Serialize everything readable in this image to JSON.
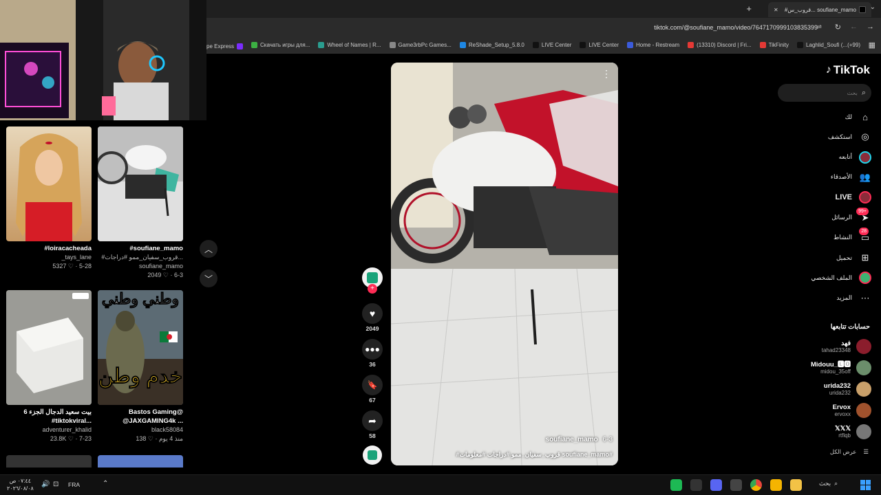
{
  "browser": {
    "tab_title": "#قروب_س... soufiane_mamo",
    "url": "tiktok.com/@soufiane_mamo/video/7647170999103835399",
    "bookmarks": [
      {
        "label": "pe Express",
        "color": "#7b2cff"
      },
      {
        "label": "Скачать игры для...",
        "color": "#3cb043"
      },
      {
        "label": "Wheel of Names | R...",
        "color": "#2a9d8f"
      },
      {
        "label": "Game3rbPc Games...",
        "color": "#888"
      },
      {
        "label": "ReShade_Setup_5.8.0",
        "color": "#1e88e5"
      },
      {
        "label": "LIVE Center",
        "color": "#111"
      },
      {
        "label": "LIVE Center",
        "color": "#111"
      },
      {
        "label": "Home - Restream",
        "color": "#3b5bdb"
      },
      {
        "label": "(13310) Discord | Fri...",
        "color": "#e53935"
      },
      {
        "label": "TikFinity",
        "color": "#e53935"
      },
      {
        "label": "Laghlid_Soufi (...(+99)",
        "color": "#111"
      }
    ]
  },
  "left_cards": [
    {
      "title": "#loiracacheada",
      "user": "_tays_lane",
      "likes": "5327",
      "date": "5-28"
    },
    {
      "title": "#soufiane_mamo",
      "subtitle": "#قروب_سفيان_ممو #دراجات...",
      "user": "soufiane_mamo",
      "likes": "2049",
      "date": "6-3"
    },
    {
      "title": "بيت سعيد الدجال الجزء 6",
      "subtitle": "#tiktokviral...",
      "user": "adventurer_khalid",
      "likes": "23.8K",
      "date": "7-23"
    },
    {
      "title": "Bastos Gaming@",
      "subtitle": "@JAXGAMING4k ...",
      "user": "black58084",
      "likes": "138",
      "date": "منذ 4 يوم"
    }
  ],
  "thumb_text": "وطني وطني",
  "thumb_text2": "خدم وطن",
  "video": {
    "author": "soufiane_mamo",
    "date": "6-3",
    "caption": "#قروب_سفيان_ممو #دراجات #معلومات soufiane_mamo#"
  },
  "actions": {
    "likes": "2049",
    "comments": "36",
    "saves": "67",
    "shares": "58"
  },
  "tiktok": {
    "logo": "TikTok",
    "search_placeholder": "بحث",
    "nav": [
      {
        "label": "لك",
        "icon": "home-icon"
      },
      {
        "label": "استكشف",
        "icon": "compass-icon"
      },
      {
        "label": "أتابعه",
        "icon": "following-icon"
      },
      {
        "label": "الأصدقاء",
        "icon": "friends-icon"
      },
      {
        "label": "LIVE",
        "icon": "live-icon"
      },
      {
        "label": "الرسائل",
        "icon": "messages-icon",
        "badge": "99+"
      },
      {
        "label": "النشاط",
        "icon": "activity-icon",
        "badge": "28"
      },
      {
        "label": "تحميل",
        "icon": "upload-icon"
      },
      {
        "label": "الملف الشخصي",
        "icon": "profile-icon"
      },
      {
        "label": "المزيد",
        "icon": "more-icon"
      }
    ],
    "following_title": "حسابات تتابعها",
    "following": [
      {
        "name": "فهد",
        "user": "tahad23348",
        "color": "#8b1d2c"
      },
      {
        "name": "Midouu_🅻🅾",
        "user": "midou_35off",
        "color": "#6b8e6b"
      },
      {
        "name": "urida232",
        "user": "urida232",
        "color": "#c9a06a"
      },
      {
        "name": "Ervox",
        "user": "ervoxx",
        "color": "#a0522d"
      },
      {
        "name": "𝕏𝕏𝕏",
        "user": "rtflqb",
        "color": "#777"
      }
    ],
    "see_all": "عرض الكل"
  },
  "taskbar": {
    "search": "بحث",
    "lang": "FRA",
    "time": "٠٧:٤٤ ص",
    "date": "٢٠٢٦/٠٨/٠٨"
  }
}
